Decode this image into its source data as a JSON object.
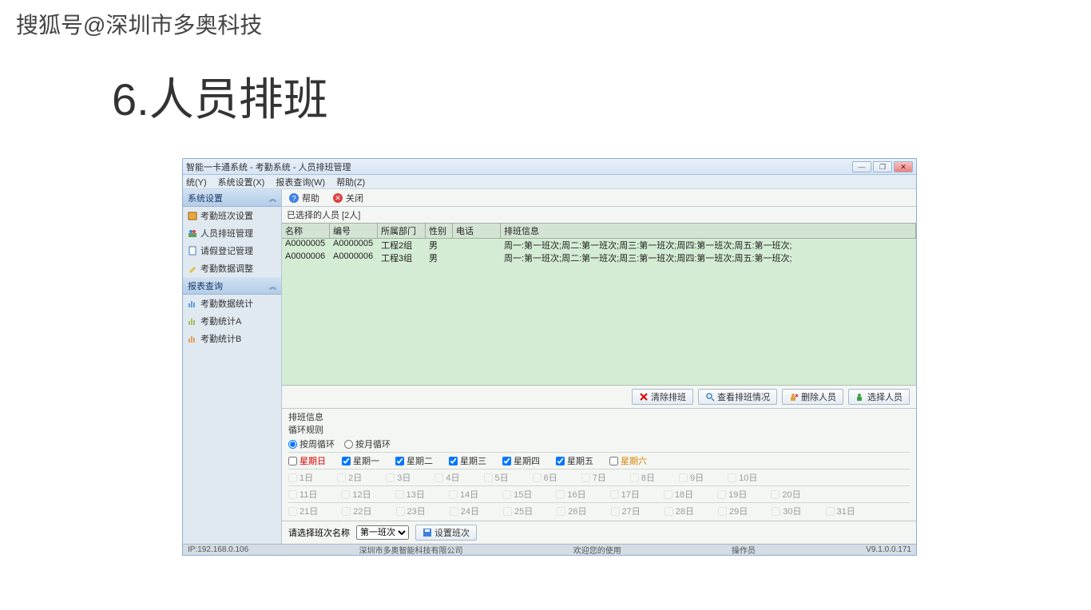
{
  "watermark": "搜狐号@深圳市多奥科技",
  "slide_title": "6.人员排班",
  "window": {
    "title": "智能一卡通系统 - 考勤系统 - 人员排班管理",
    "min": "—",
    "max": "❐",
    "close": "✕"
  },
  "menubar": {
    "sys": "统(Y)",
    "settings": "系统设置(X)",
    "report": "报表查询(W)",
    "help": "帮助(Z)"
  },
  "sidebar": {
    "panel1": "系统设置",
    "items1": [
      "考勤班次设置",
      "人员排班管理",
      "请假登记管理",
      "考勤数据调整"
    ],
    "panel2": "报表查询",
    "items2": [
      "考勤数据统计",
      "考勤统计A",
      "考勤统计B"
    ]
  },
  "toolbar": {
    "help": "帮助",
    "close": "关闭"
  },
  "selected_label": "已选择的人员  [2人]",
  "grid": {
    "headers": {
      "name": "名称",
      "id": "编号",
      "dept": "所属部门",
      "sex": "性别",
      "tel": "电话",
      "sched": "排班信息"
    },
    "rows": [
      {
        "name": "A0000005",
        "id": "A0000005",
        "dept": "工程2组",
        "sex": "男",
        "tel": "",
        "sched": "周一:第一班次;周二:第一班次;周三:第一班次;周四:第一班次;周五:第一班次;"
      },
      {
        "name": "A0000006",
        "id": "A0000006",
        "dept": "工程3组",
        "sex": "男",
        "tel": "",
        "sched": "周一:第一班次;周二:第一班次;周三:第一班次;周四:第一班次;周五:第一班次;"
      }
    ]
  },
  "actions": {
    "clear": "清除排班",
    "view": "查看排班情况",
    "delete": "删除人员",
    "select": "选择人员"
  },
  "info": {
    "title": "排班信息",
    "rule": "循环规则",
    "by_week": "按周循环",
    "by_month": "按月循环"
  },
  "weekdays": [
    "星期日",
    "星期一",
    "星期二",
    "星期三",
    "星期四",
    "星期五",
    "星期六"
  ],
  "weekday_checked": [
    false,
    true,
    true,
    true,
    true,
    true,
    false
  ],
  "days_row1": [
    "1日",
    "2日",
    "3日",
    "4日",
    "5日",
    "6日",
    "7日",
    "8日",
    "9日",
    "10日"
  ],
  "days_row2": [
    "11日",
    "12日",
    "13日",
    "14日",
    "15日",
    "16日",
    "17日",
    "18日",
    "19日",
    "20日"
  ],
  "days_row3": [
    "21日",
    "22日",
    "23日",
    "24日",
    "25日",
    "26日",
    "27日",
    "28日",
    "29日",
    "30日",
    "31日"
  ],
  "bottom": {
    "label": "请选择班次名称",
    "shift": "第一班次",
    "set": "设置班次"
  },
  "statusbar": {
    "ip": "IP:192.168.0.106",
    "company": "深圳市多奥智能科技有限公司",
    "welcome": "欢迎您的使用",
    "operator": "操作员",
    "version": "V9.1.0.0.171"
  }
}
